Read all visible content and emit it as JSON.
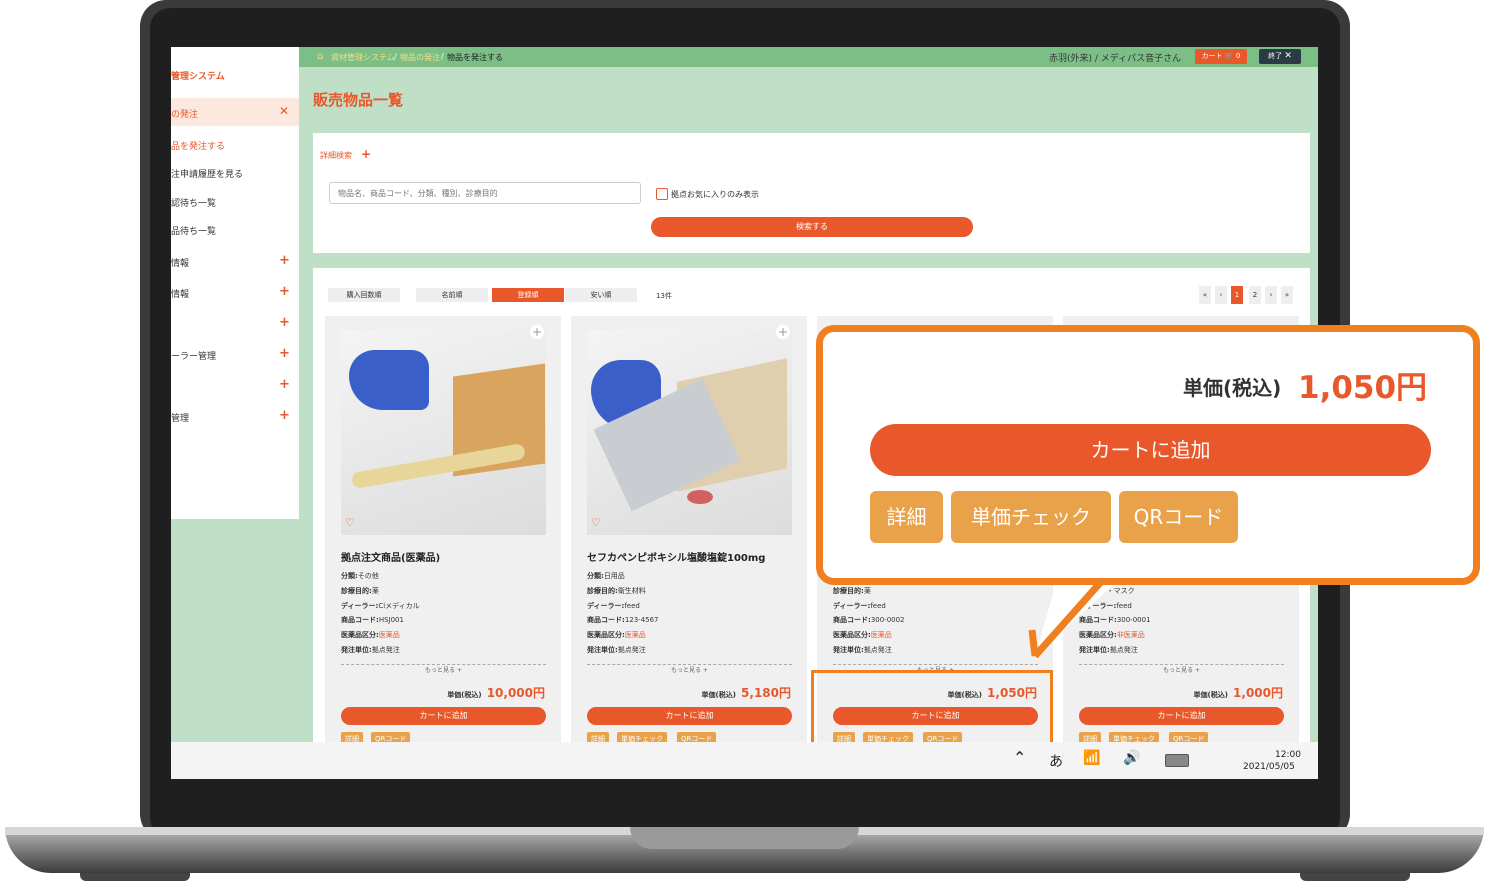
{
  "breadcrumb": {
    "item1": "資材管理システム",
    "item2": "物品の発注",
    "item3": "物品を発注する",
    "sep": "/"
  },
  "header": {
    "user": "赤羽(外来) / メディパス音子さん",
    "cart_label": "カート",
    "cart_count": "0",
    "end_label": "終了"
  },
  "sidebar": {
    "system_name": "管理システム",
    "section_order": "の発注",
    "items": [
      {
        "label": "品を発注する"
      },
      {
        "label": "注申請履歴を見る"
      },
      {
        "label": "認待ち一覧"
      },
      {
        "label": "品待ち一覧"
      }
    ],
    "groups": [
      {
        "label": "情報"
      },
      {
        "label": "情報"
      },
      {
        "label": ""
      },
      {
        "label": "ーラー管理"
      },
      {
        "label": ""
      },
      {
        "label": "管理"
      }
    ]
  },
  "main": {
    "title": "販売物品一覧",
    "search": {
      "detail_toggle": "詳細検索",
      "placeholder": "物品名、商品コード、分類、種別、診療目的",
      "favorite_checkbox": "拠点お気に入りのみ表示",
      "submit": "検索する"
    },
    "sort_tabs": [
      "購入回数順",
      "名前順",
      "登録順",
      "安い順"
    ],
    "active_sort": "登録順",
    "count": "13件",
    "pagination": [
      "«",
      "‹",
      "1",
      "2",
      "›",
      "»"
    ],
    "current_page": "1"
  },
  "labels": {
    "category": "分類:",
    "purpose": "診療目的:",
    "dealer": "ディーラー:",
    "code": "商品コード:",
    "drug_class": "医薬品区分:",
    "unit": "発注単位:",
    "more": "もっと見る +",
    "price_label": "単価(税込)",
    "add_to_cart": "カートに追加",
    "detail": "詳細",
    "price_check": "単価チェック",
    "qr": "QRコード"
  },
  "products": [
    {
      "name": "拠点注文商品(医薬品)",
      "category": "その他",
      "purpose": "薬",
      "dealer": "Ciメディカル",
      "code": "HSJ001",
      "drug_class": "医薬品",
      "unit": "拠点発注",
      "price": "10,000円"
    },
    {
      "name": "セフカペンピボキシル塩酸塩錠100mg",
      "category": "日用品",
      "purpose": "衛生材料",
      "dealer": "feed",
      "code": "123-4567",
      "drug_class": "医薬品",
      "unit": "拠点発注",
      "price": "5,180円"
    },
    {
      "name": "",
      "category": "",
      "purpose": "薬",
      "dealer": "feed",
      "code": "300-0002",
      "drug_class": "医薬品",
      "unit": "拠点発注",
      "price": "1,050円"
    },
    {
      "name": "",
      "category": "",
      "purpose": "グローブ・マスク",
      "dealer": "feed",
      "code": "300-0001",
      "drug_class": "非医薬品",
      "unit": "拠点発注",
      "price": "1,000円"
    }
  ],
  "callout": {
    "price_label": "単価(税込)",
    "price": "1,050円",
    "add_to_cart": "カートに追加",
    "detail": "詳細",
    "price_check": "単価チェック",
    "qr": "QRコード"
  },
  "taskbar": {
    "ime": "あ",
    "time": "12:00",
    "date": "202‌1/05/05"
  },
  "colors": {
    "accent": "#e8582a",
    "header_green": "#7bbf86",
    "page_green": "#c0dfc7",
    "sub_button": "#e9a24a",
    "callout_border": "#f07f1f"
  }
}
